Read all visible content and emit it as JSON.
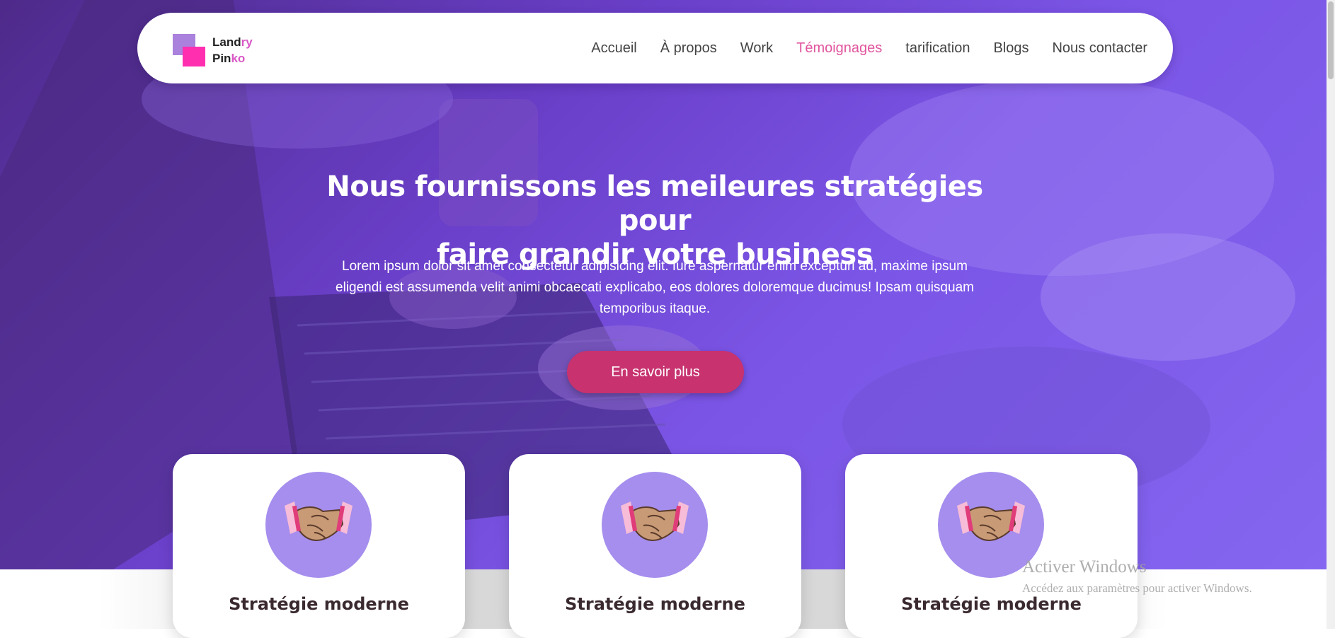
{
  "brand": {
    "line1_main": "Land",
    "line1_accent": "ry",
    "line2_main": "Pin",
    "line2_accent": "ko"
  },
  "nav": {
    "items": [
      "Accueil",
      "À propos",
      "Work",
      "Témoignages",
      "tarification",
      "Blogs",
      "Nous contacter"
    ],
    "active": "Témoignages"
  },
  "hero": {
    "headline_line1": "Nous fournissons les meileures stratégies pour",
    "headline_line2": "faire grandir votre business",
    "paragraph": "Lorem ipsum dolor sit amet consectetur adipisicing elit. Iure aspernatur enim excepturi ad, maxime ipsum eligendi est assumenda velit animi obcaecati explicabo, eos dolores doloremque ducimus! Ipsam quisquam temporibus itaque.",
    "cta_label": "En savoir plus"
  },
  "cards": [
    {
      "title": "Stratégie moderne",
      "icon": "handshake-icon"
    },
    {
      "title": "Stratégie moderne",
      "icon": "handshake-icon"
    },
    {
      "title": "Stratégie moderne",
      "icon": "handshake-icon"
    }
  ],
  "watermark": {
    "title": "Activer Windows",
    "subtitle": "Accédez aux paramètres pour activer Windows."
  },
  "colors": {
    "accent": "#e0559e",
    "cta": "#c7326f",
    "hero_purple": "#7b55e6",
    "icon_circle": "#a58eed"
  }
}
